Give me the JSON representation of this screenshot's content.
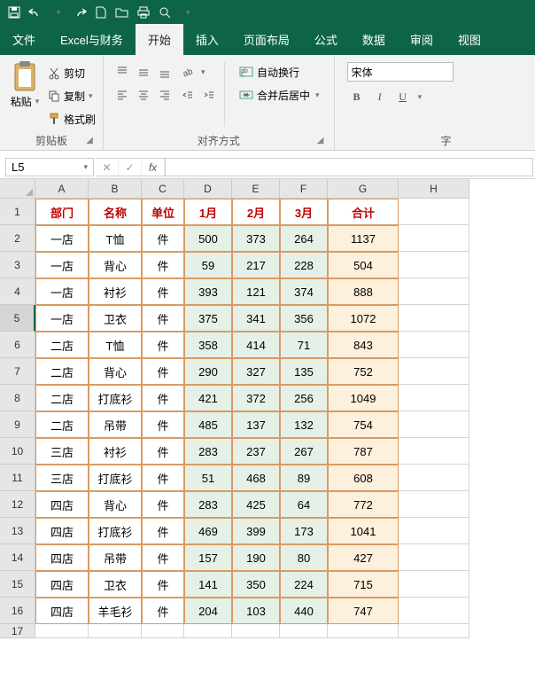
{
  "qat": {
    "save": "save",
    "undo": "undo",
    "redo": "redo",
    "new": "new",
    "open": "open",
    "print": "print",
    "preview": "preview"
  },
  "tabs": [
    "文件",
    "Excel与财务",
    "开始",
    "插入",
    "页面布局",
    "公式",
    "数据",
    "审阅",
    "视图"
  ],
  "activeTab": 2,
  "ribbon": {
    "clipboard": {
      "label": "剪贴板",
      "paste": "粘贴",
      "cut": "剪切",
      "copy": "复制",
      "painter": "格式刷"
    },
    "alignment": {
      "label": "对齐方式",
      "wrap": "自动换行",
      "merge": "合并后居中"
    },
    "font": {
      "label": "字",
      "name": "宋体",
      "bold": "B",
      "italic": "I",
      "underline": "U"
    }
  },
  "nameBox": "L5",
  "fxValue": "",
  "columns": [
    "A",
    "B",
    "C",
    "D",
    "E",
    "F",
    "G",
    "H"
  ],
  "rowCount": 17,
  "selectedRow": 5,
  "headers": [
    "部门",
    "名称",
    "单位",
    "1月",
    "2月",
    "3月",
    "合计"
  ],
  "rows": [
    [
      "一店",
      "T恤",
      "件",
      "500",
      "373",
      "264",
      "1137"
    ],
    [
      "一店",
      "背心",
      "件",
      "59",
      "217",
      "228",
      "504"
    ],
    [
      "一店",
      "衬衫",
      "件",
      "393",
      "121",
      "374",
      "888"
    ],
    [
      "一店",
      "卫衣",
      "件",
      "375",
      "341",
      "356",
      "1072"
    ],
    [
      "二店",
      "T恤",
      "件",
      "358",
      "414",
      "71",
      "843"
    ],
    [
      "二店",
      "背心",
      "件",
      "290",
      "327",
      "135",
      "752"
    ],
    [
      "二店",
      "打底衫",
      "件",
      "421",
      "372",
      "256",
      "1049"
    ],
    [
      "二店",
      "吊带",
      "件",
      "485",
      "137",
      "132",
      "754"
    ],
    [
      "三店",
      "衬衫",
      "件",
      "283",
      "237",
      "267",
      "787"
    ],
    [
      "三店",
      "打底衫",
      "件",
      "51",
      "468",
      "89",
      "608"
    ],
    [
      "四店",
      "背心",
      "件",
      "283",
      "425",
      "64",
      "772"
    ],
    [
      "四店",
      "打底衫",
      "件",
      "469",
      "399",
      "173",
      "1041"
    ],
    [
      "四店",
      "吊带",
      "件",
      "157",
      "190",
      "80",
      "427"
    ],
    [
      "四店",
      "卫衣",
      "件",
      "141",
      "350",
      "224",
      "715"
    ],
    [
      "四店",
      "羊毛衫",
      "件",
      "204",
      "103",
      "440",
      "747"
    ]
  ],
  "chart_data": {
    "type": "table",
    "title": "",
    "columns": [
      "部门",
      "名称",
      "单位",
      "1月",
      "2月",
      "3月",
      "合计"
    ],
    "data": [
      {
        "部门": "一店",
        "名称": "T恤",
        "单位": "件",
        "1月": 500,
        "2月": 373,
        "3月": 264,
        "合计": 1137
      },
      {
        "部门": "一店",
        "名称": "背心",
        "单位": "件",
        "1月": 59,
        "2月": 217,
        "3月": 228,
        "合计": 504
      },
      {
        "部门": "一店",
        "名称": "衬衫",
        "单位": "件",
        "1月": 393,
        "2月": 121,
        "3月": 374,
        "合计": 888
      },
      {
        "部门": "一店",
        "名称": "卫衣",
        "单位": "件",
        "1月": 375,
        "2月": 341,
        "3月": 356,
        "合计": 1072
      },
      {
        "部门": "二店",
        "名称": "T恤",
        "单位": "件",
        "1月": 358,
        "2月": 414,
        "3月": 71,
        "合计": 843
      },
      {
        "部门": "二店",
        "名称": "背心",
        "单位": "件",
        "1月": 290,
        "2月": 327,
        "3月": 135,
        "合计": 752
      },
      {
        "部门": "二店",
        "名称": "打底衫",
        "单位": "件",
        "1月": 421,
        "2月": 372,
        "3月": 256,
        "合计": 1049
      },
      {
        "部门": "二店",
        "名称": "吊带",
        "单位": "件",
        "1月": 485,
        "2月": 137,
        "3月": 132,
        "合计": 754
      },
      {
        "部门": "三店",
        "名称": "衬衫",
        "单位": "件",
        "1月": 283,
        "2月": 237,
        "3月": 267,
        "合计": 787
      },
      {
        "部门": "三店",
        "名称": "打底衫",
        "单位": "件",
        "1月": 51,
        "2月": 468,
        "3月": 89,
        "合计": 608
      },
      {
        "部门": "四店",
        "名称": "背心",
        "单位": "件",
        "1月": 283,
        "2月": 425,
        "3月": 64,
        "合计": 772
      },
      {
        "部门": "四店",
        "名称": "打底衫",
        "单位": "件",
        "1月": 469,
        "2月": 399,
        "3月": 173,
        "合计": 1041
      },
      {
        "部门": "四店",
        "名称": "吊带",
        "单位": "件",
        "1月": 157,
        "2月": 190,
        "3月": 80,
        "合计": 427
      },
      {
        "部门": "四店",
        "名称": "卫衣",
        "单位": "件",
        "1月": 141,
        "2月": 350,
        "3月": 224,
        "合计": 715
      },
      {
        "部门": "四店",
        "名称": "羊毛衫",
        "单位": "件",
        "1月": 204,
        "2月": 103,
        "3月": 440,
        "合计": 747
      }
    ]
  }
}
